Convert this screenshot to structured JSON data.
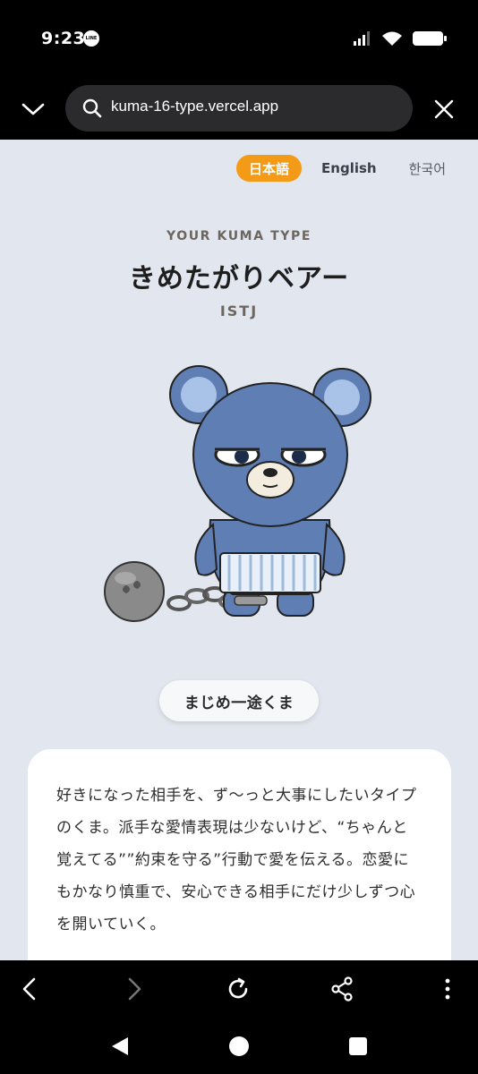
{
  "status_bar": {
    "time": "9:23",
    "notification_app": "LINE",
    "icons": [
      "signal-icon",
      "wifi-icon",
      "battery-icon"
    ]
  },
  "browser": {
    "url": "kuma-16-type.vercel.app",
    "icons": [
      "chevron-down-icon",
      "search-icon",
      "close-icon"
    ]
  },
  "page": {
    "languages": [
      {
        "label": "日本語",
        "active": true
      },
      {
        "label": "English",
        "active": false
      },
      {
        "label": "한국어",
        "active": false
      }
    ],
    "type_label": "YOUR KUMA TYPE",
    "type_name": "きめたがりベアー",
    "type_code": "ISTJ",
    "tag": "まじめ一途くま",
    "description": "好きになった相手を、ず〜っと大事にしたいタイプのくま。派手な愛情表現は少ないけど、“ちゃんと覚えてる””約束を守る”行動で愛を伝える。恋愛にもかなり慎重で、安心できる相手にだけ少しずつ心を開いていく。"
  },
  "toolbar": {
    "icons": [
      "back-icon",
      "forward-icon",
      "reload-icon",
      "share-icon",
      "more-icon"
    ]
  },
  "system_nav": {
    "icons": [
      "nav-back-icon",
      "nav-home-icon",
      "nav-recents-icon"
    ]
  },
  "colors": {
    "accent": "#f39a16",
    "page_bg": "#e2e6ee",
    "bear_body": "#5f7fb4",
    "bear_light": "#a9c3e8"
  }
}
